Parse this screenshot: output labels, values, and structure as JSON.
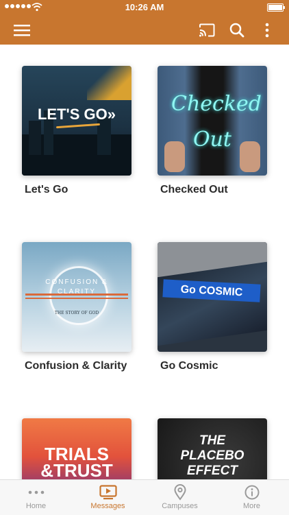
{
  "status_bar": {
    "time": "10:26 AM"
  },
  "app_bar": {
    "icons": [
      "menu-icon",
      "cast-icon",
      "search-icon",
      "more-vertical-icon"
    ],
    "color": "#c8762f"
  },
  "messages": [
    {
      "title": "Let's Go",
      "art_text": "LET'S GO»"
    },
    {
      "title": "Checked Out",
      "art_text": "Checked Out"
    },
    {
      "title": "Confusion & Clarity",
      "art_text": "CONFUSION & CLARITY",
      "art_subtext": "THE STORY OF GOD"
    },
    {
      "title": "Go Cosmic",
      "art_text": "Go COSMIC"
    },
    {
      "title": "Trials & Trust",
      "art_text": "TRIALS &TRUST"
    },
    {
      "title": "The Placebo Effect",
      "art_text": "THE PLACEBO EFFECT"
    }
  ],
  "tabs": [
    {
      "label": "Home",
      "icon": "dots-icon",
      "active": false
    },
    {
      "label": "Messages",
      "icon": "video-icon",
      "active": true
    },
    {
      "label": "Campuses",
      "icon": "location-pin-icon",
      "active": false
    },
    {
      "label": "More",
      "icon": "info-icon",
      "active": false
    }
  ]
}
